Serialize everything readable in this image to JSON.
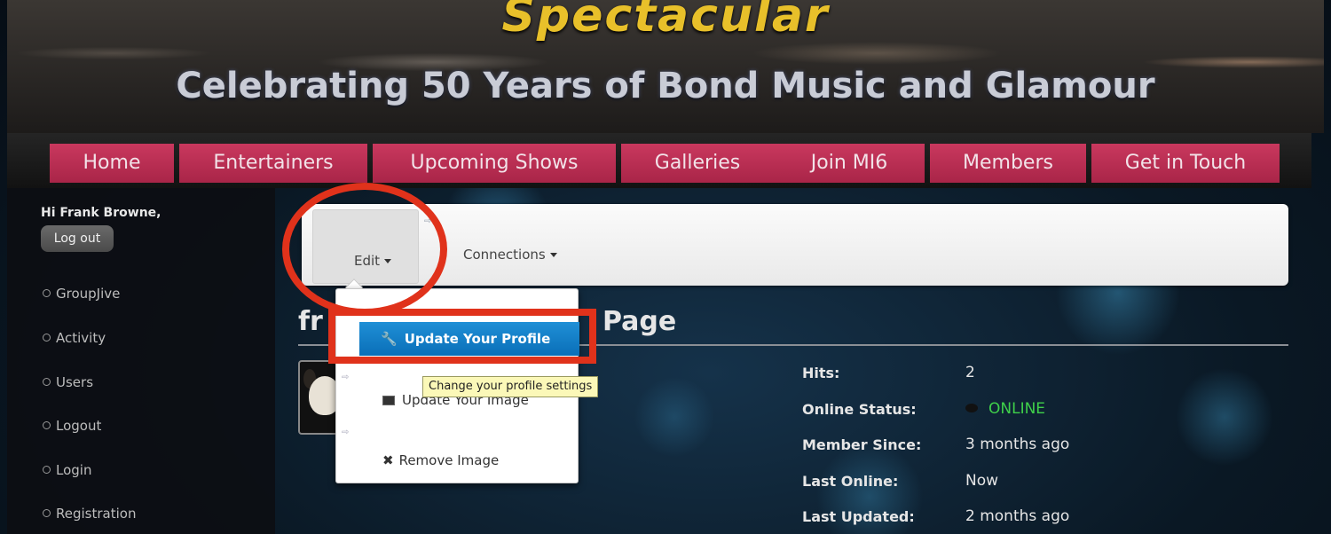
{
  "header": {
    "title": "Spectacular",
    "subtitle": "Celebrating 50 Years of Bond Music and Glamour"
  },
  "nav": {
    "items": [
      "Home",
      "Entertainers",
      "Upcoming Shows",
      "Galleries",
      "Join MI6",
      "Members",
      "Get in Touch"
    ]
  },
  "sidebar": {
    "greeting": "Hi Frank Browne,",
    "logout_button": "Log out",
    "links": [
      "GroupJive",
      "Activity",
      "Users",
      "Logout",
      "Login",
      "Registration"
    ]
  },
  "toolbar": {
    "edit_label": "Edit",
    "connections_label": "Connections"
  },
  "main": {
    "heading_left": "fr",
    "heading_right": "Page"
  },
  "dropdown": {
    "items": [
      {
        "label": "Update Your Profile",
        "icon": "wrench-icon"
      },
      {
        "label": "Update Your Image",
        "icon": "image-icon"
      },
      {
        "label": "Remove Image",
        "icon": "close-icon"
      }
    ],
    "tooltip": "Change your profile settings"
  },
  "profile_stats": [
    {
      "label": "Hits:",
      "value": "2"
    },
    {
      "label": "Online Status:",
      "value": "ONLINE"
    },
    {
      "label": "Member Since:",
      "value": "3 months ago"
    },
    {
      "label": "Last Online:",
      "value": "Now"
    },
    {
      "label": "Last Updated:",
      "value": "2 months ago"
    }
  ],
  "colors": {
    "nav_button": "#b92e53",
    "highlight": "#e0321b",
    "online": "#3fd04a",
    "active_item": "#1680c8"
  }
}
